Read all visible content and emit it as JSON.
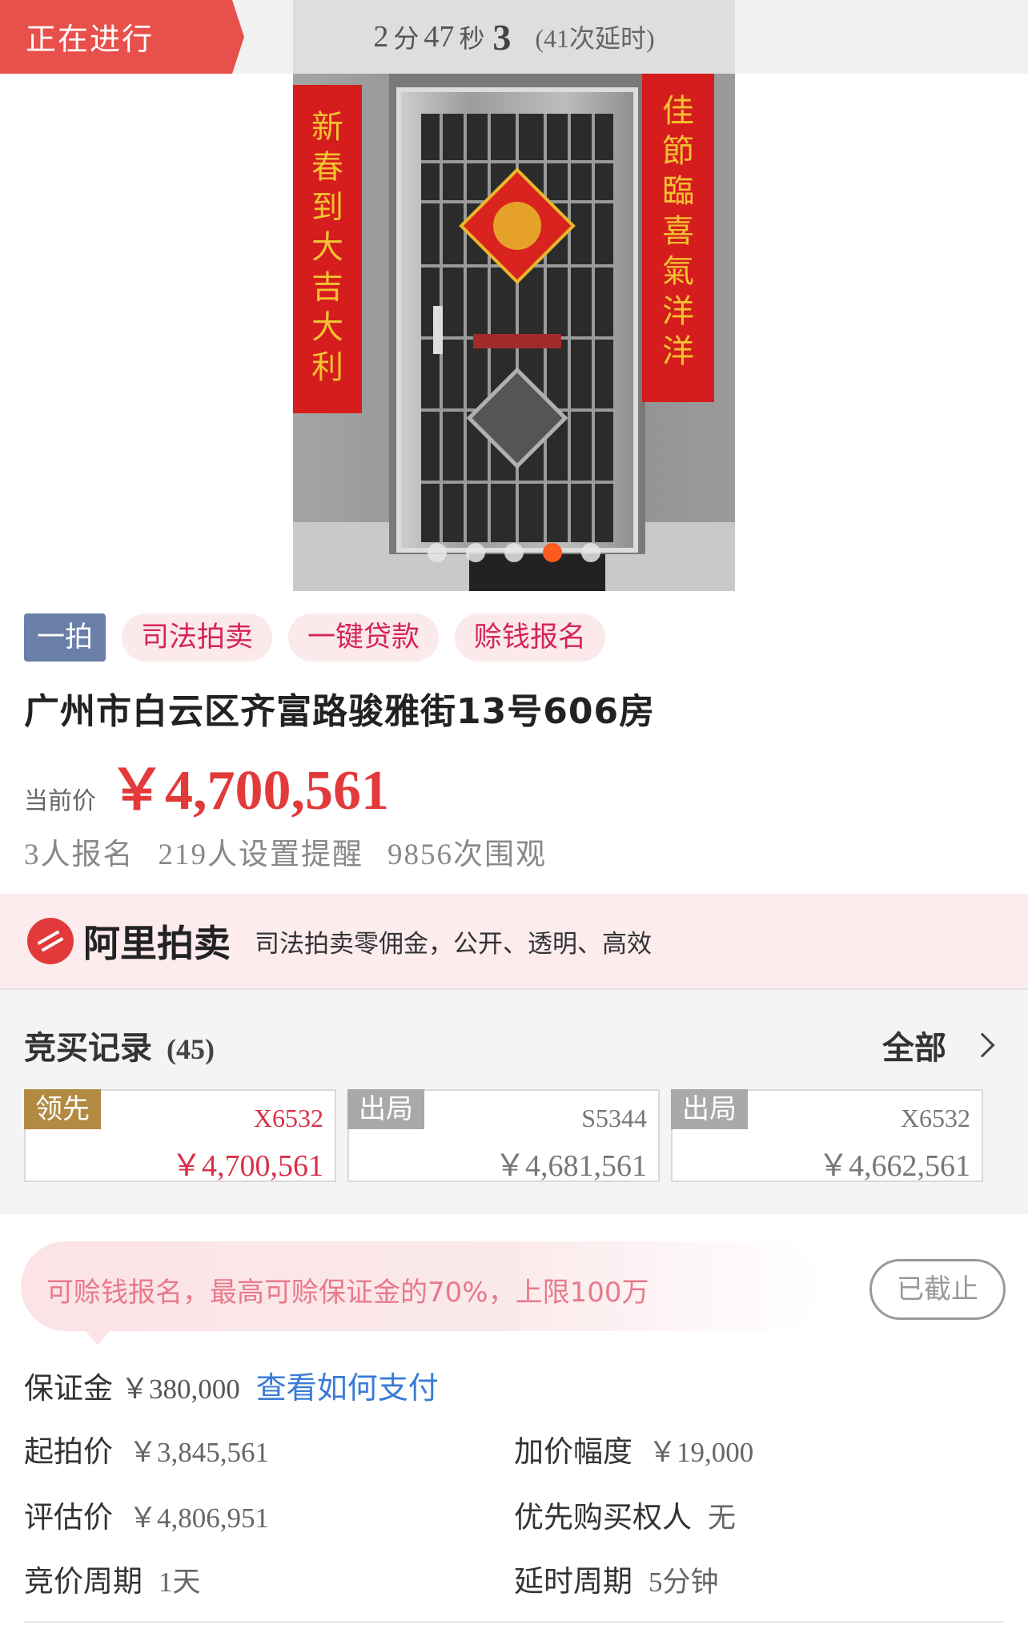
{
  "status": {
    "label": "正在进行"
  },
  "countdown": {
    "minutes": "2",
    "minutes_unit": "分",
    "seconds": "47",
    "seconds_unit": "秒",
    "fraction": "3",
    "extension": "(41次延时)"
  },
  "gallery": {
    "couplet_left": "新春到大吉大利",
    "couplet_right": "佳節臨喜氣洋洋",
    "dots_total": 5,
    "active_index": 3,
    "colors": {
      "door": "#b9b9b9",
      "couplet": "#d51d1d",
      "gold_text": "#f2c230",
      "active_dot": "#ff5a1f"
    }
  },
  "tags": {
    "round": "一拍",
    "judicial": "司法拍卖",
    "loan": "一键贷款",
    "earn": "赊钱报名"
  },
  "item": {
    "title": "广州市白云区齐富路骏雅街13号606房"
  },
  "price": {
    "label": "当前价",
    "value": "￥4,700,561"
  },
  "stats": {
    "signups": "3人报名",
    "reminders": "219人设置提醒",
    "views": "9856次围观"
  },
  "ali_banner": {
    "brand": "阿里拍卖",
    "slogan": "司法拍卖零佣金，公开、透明、高效"
  },
  "bids": {
    "title": "竞买记录",
    "count": "(45)",
    "all_label": "全部",
    "records": [
      {
        "status": "领先",
        "user": "X6532",
        "amount": "￥4,700,561"
      },
      {
        "status": "出局",
        "user": "S5344",
        "amount": "￥4,681,561"
      },
      {
        "status": "出局",
        "user": "X6532",
        "amount": "￥4,662,561"
      }
    ]
  },
  "loan_notice": {
    "text": "可赊钱报名，最高可赊保证金的70%，上限100万",
    "button": "已截止"
  },
  "deposit": {
    "label": "保证金",
    "value": "￥380,000",
    "link": "查看如何支付"
  },
  "details": {
    "start_price_label": "起拍价",
    "start_price": "￥3,845,561",
    "increment_label": "加价幅度",
    "increment": "￥19,000",
    "appraisal_label": "评估价",
    "appraisal": "￥4,806,951",
    "priority_label": "优先购买权人",
    "priority": "无",
    "period_label": "竞价周期",
    "period": "1天",
    "delay_label": "延时周期",
    "delay": "5分钟"
  }
}
